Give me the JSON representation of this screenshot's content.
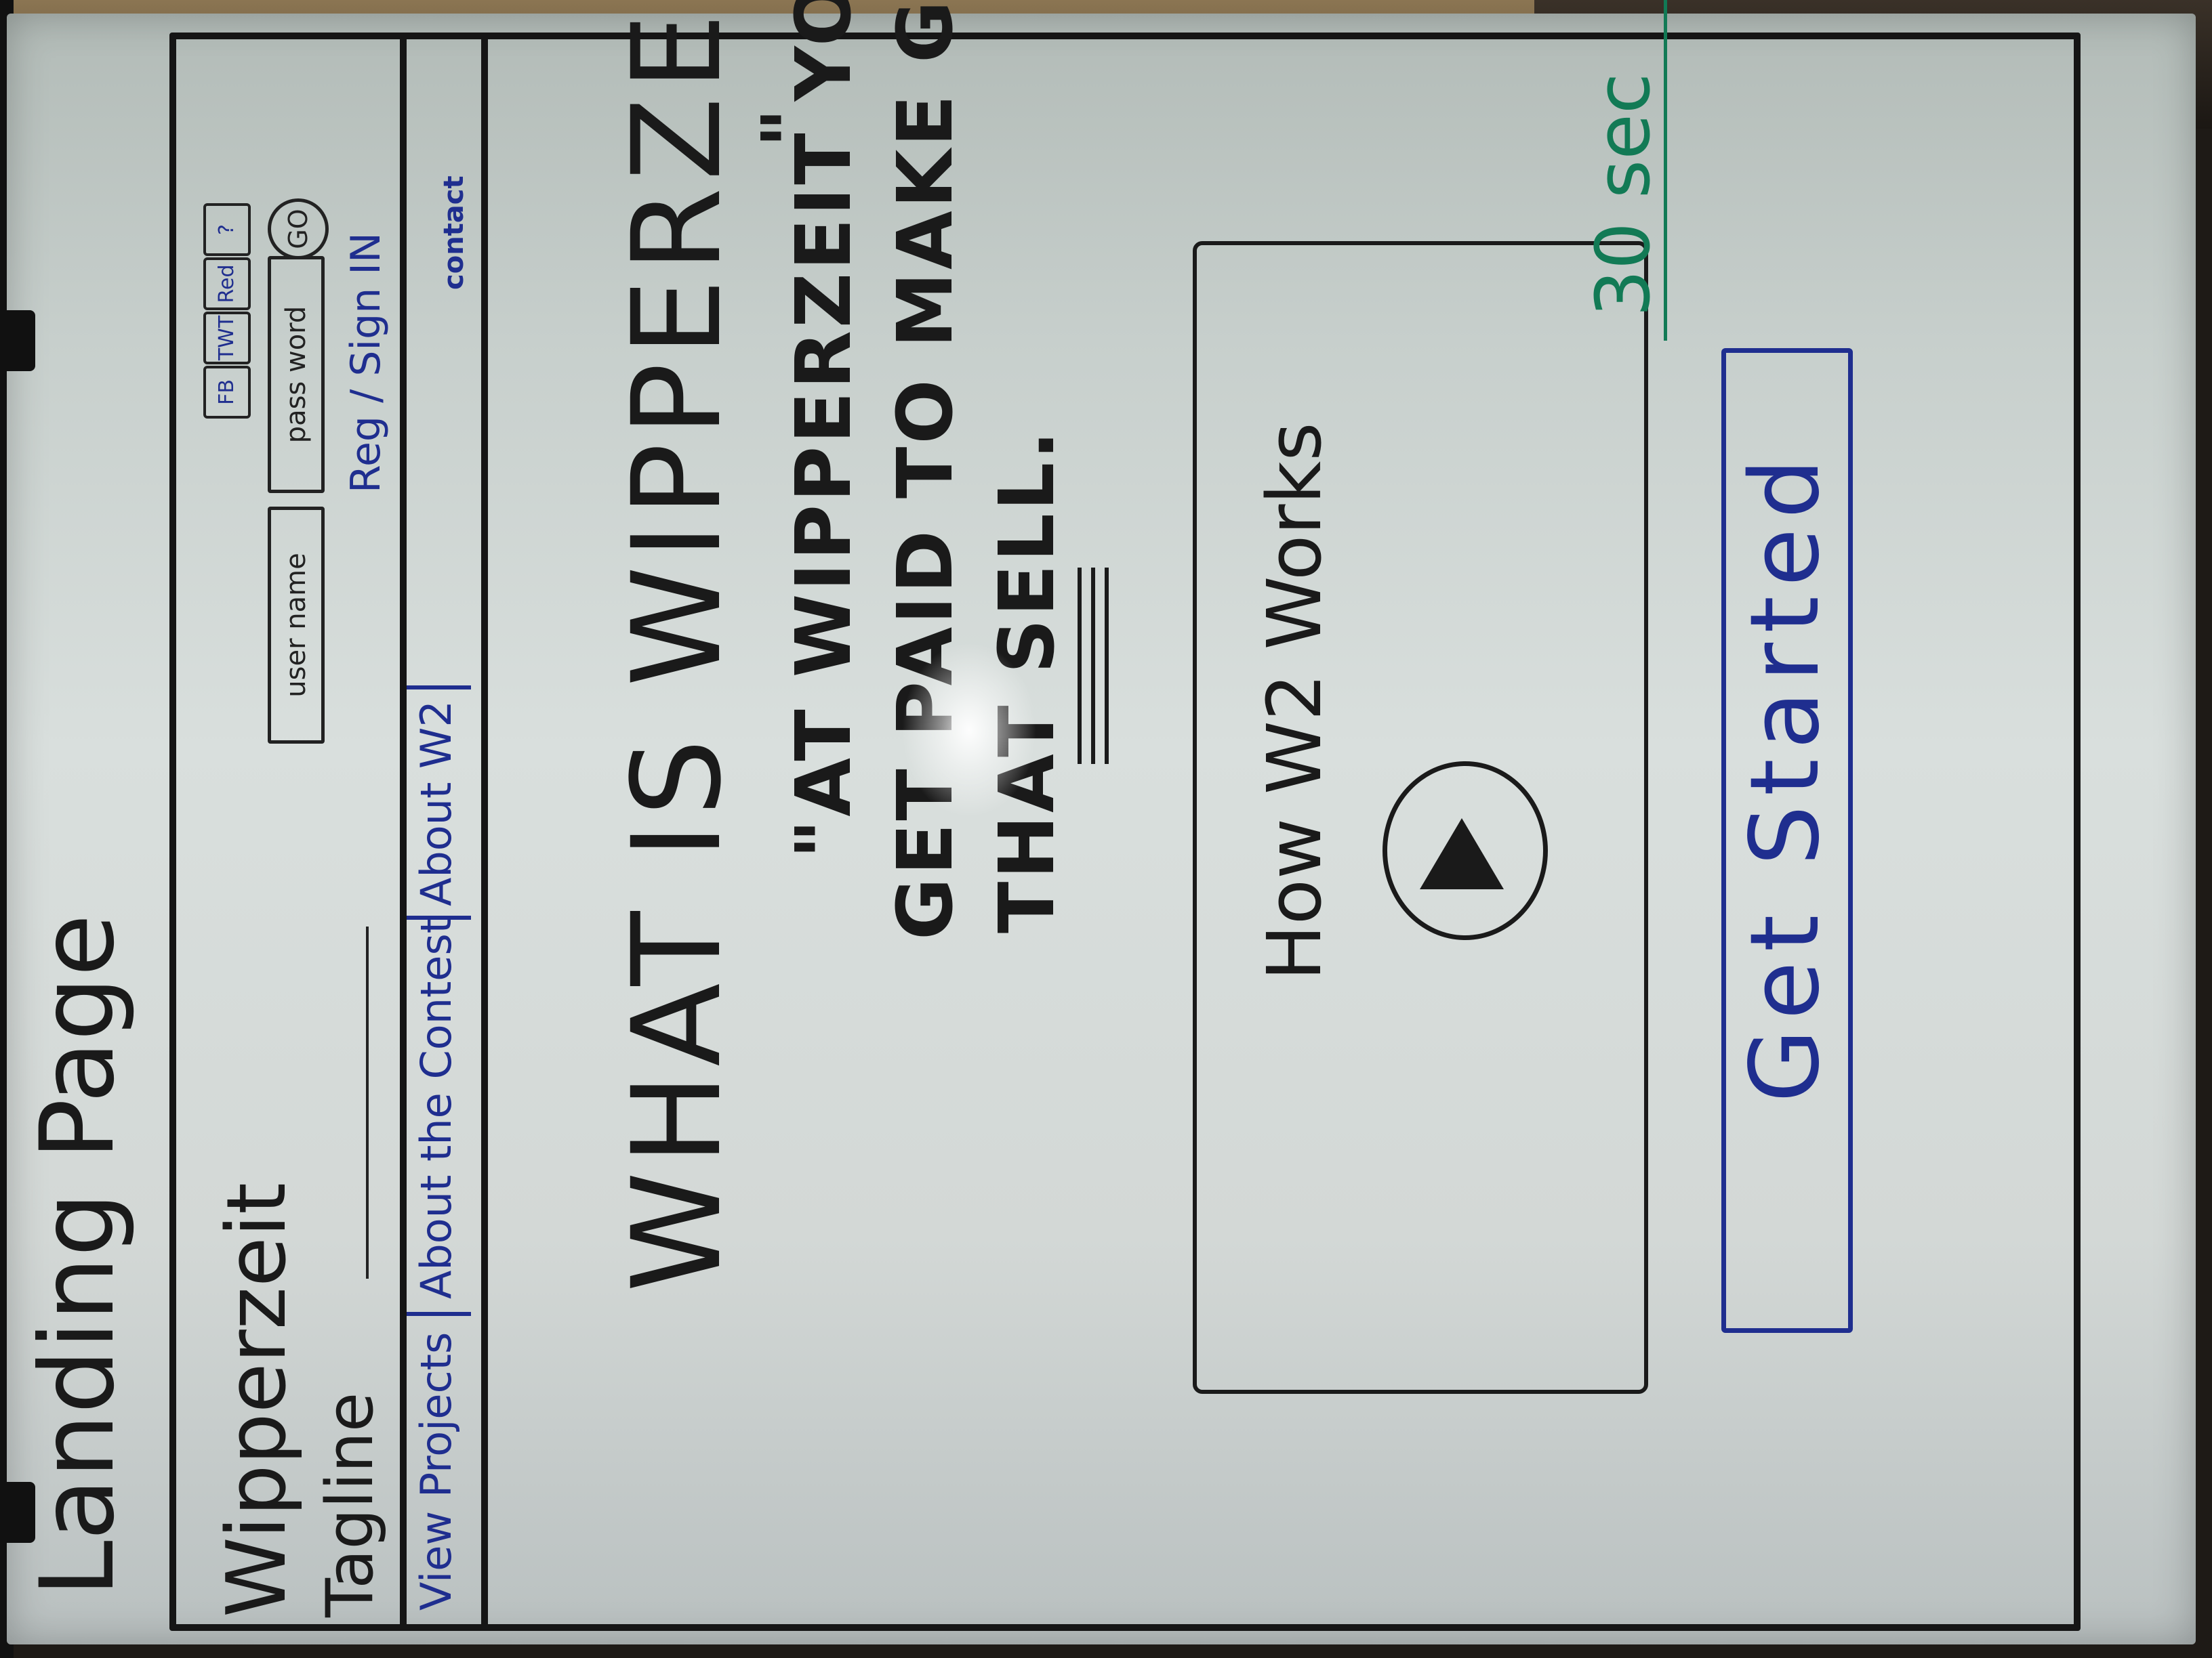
{
  "page_title": "Landing Page",
  "site_name": "Wipperzeit",
  "tagline_label": "Tagline",
  "social": {
    "facebook": "FB",
    "twitter": "TWT",
    "other": "Red",
    "help": "?"
  },
  "login": {
    "username_placeholder": "user name",
    "password_placeholder": "pass word",
    "go_label": "GO",
    "register_signin": "Reg / Sign IN"
  },
  "nav": {
    "items": [
      "View Projects",
      "About the Contest",
      "About W2"
    ],
    "contact": "contact"
  },
  "hero": {
    "heading": "WHAT IS WIPPERZEIT?",
    "quote_lines": [
      "\"AT WIPPERZEIT YOU CAN",
      "GET PAID TO MAKE GREAT GAMES",
      "THAT SELL."
    ],
    "closing_quote": "\""
  },
  "video": {
    "label": "How W2 Works",
    "duration": "30 sec"
  },
  "cta": {
    "label": "Get Started"
  },
  "colors": {
    "black_ink": "#1a1a1a",
    "blue_ink": "#1f2e8f",
    "green_ink": "#127a55",
    "whiteboard": "#d7dcda"
  }
}
